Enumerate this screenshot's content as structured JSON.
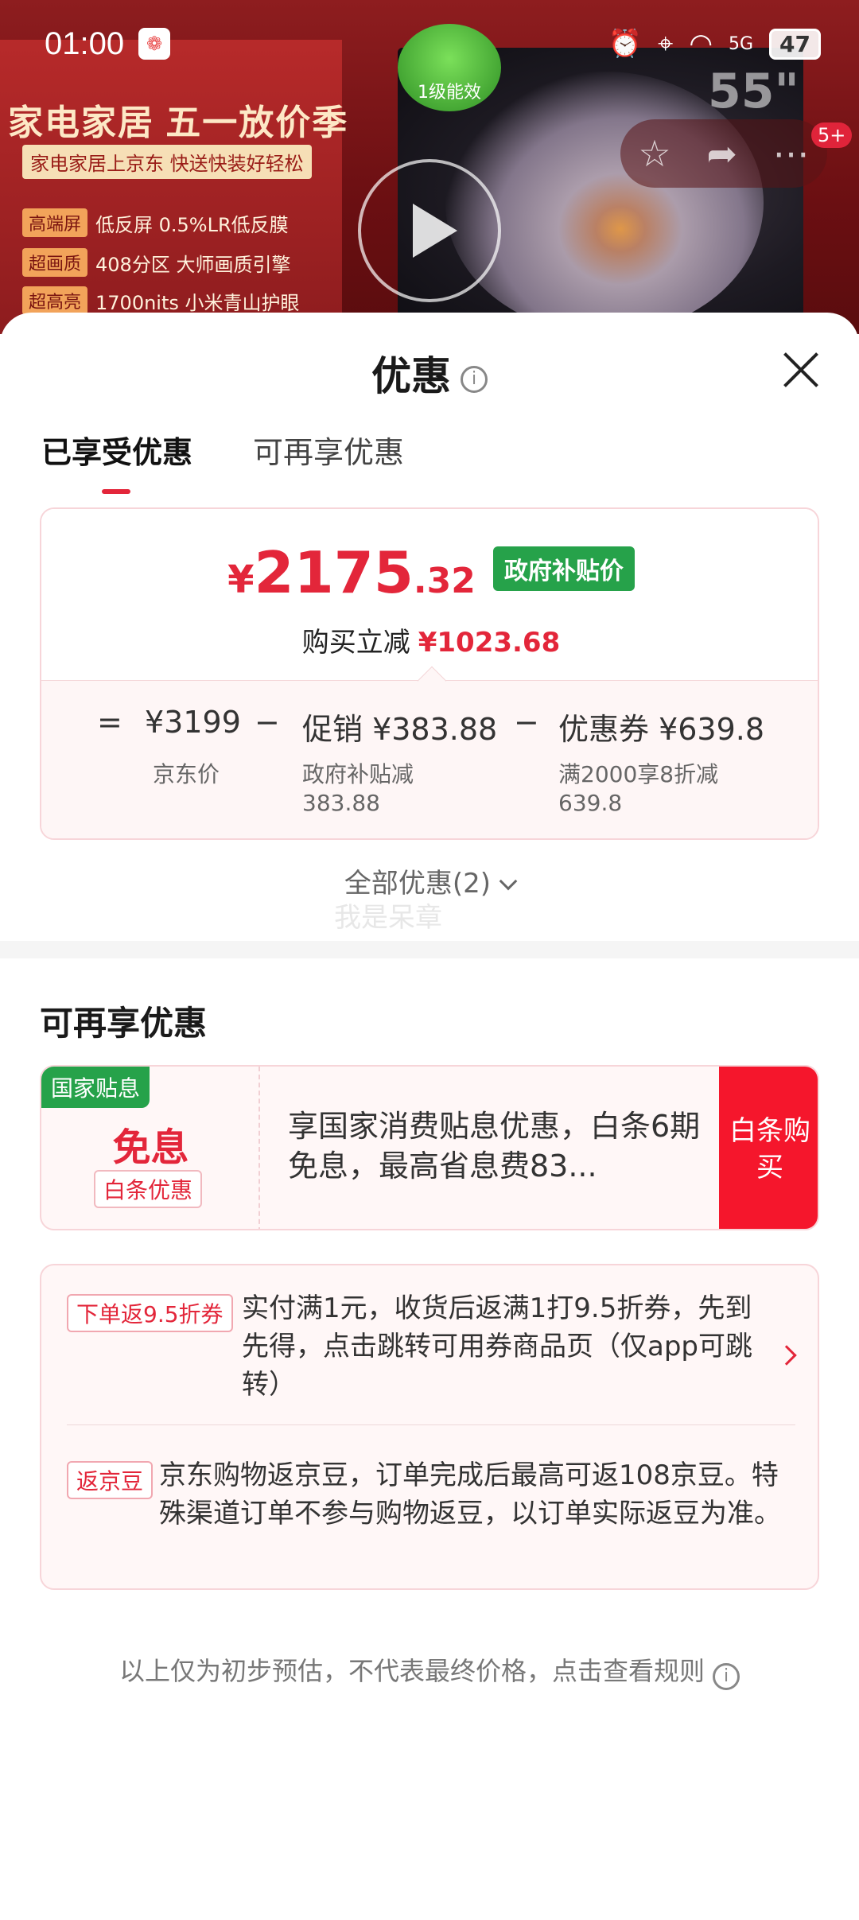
{
  "status_bar": {
    "time": "01:00",
    "battery": "47",
    "network": "5G"
  },
  "background": {
    "banner_title": "家电家居 五一放价季",
    "banner_sub": "家电家居上京东 快送快装好轻松",
    "energy_label": "1级能效",
    "screen_size": "55\"",
    "features": [
      {
        "tag": "高端屏",
        "text": "低反屏 0.5%LR低反膜"
      },
      {
        "tag": "超画质",
        "text": "408分区 大师画质引擎"
      },
      {
        "tag": "超高亮",
        "text": "1700nits 小米青山护眼"
      }
    ],
    "cart_badge": "5+"
  },
  "sheet": {
    "title": "优惠",
    "tabs": [
      {
        "label": "已享受优惠",
        "active": true
      },
      {
        "label": "可再享优惠",
        "active": false
      }
    ]
  },
  "price": {
    "currency": "¥",
    "integer": "2175",
    "decimal": ".32",
    "badge": "政府补贴价",
    "reduce_label": "购买立减",
    "reduce_amount": "¥1023.68",
    "calc": {
      "eq": "=",
      "jd_price": "¥3199",
      "minus1": "−",
      "promo": "促销 ¥383.88",
      "minus2": "−",
      "coupon": "优惠券 ¥639.8",
      "jd_label": "京东价",
      "promo_label_1": "政府补贴减",
      "promo_label_2": "383.88",
      "coupon_label_1": "满2000享8折减",
      "coupon_label_2": "639.8"
    }
  },
  "all_discounts": "全部优惠(2)",
  "watermark": "我是呆章",
  "more_section": {
    "title": "可再享优惠",
    "interest_free": {
      "tag": "国家贴息",
      "main": "免息",
      "sub": "白条优惠",
      "text": "享国家消费贴息优惠，白条6期免息，最高省息费83...",
      "button": "白条购买"
    },
    "promos": [
      {
        "tag": "下单返9.5折券",
        "text": "实付满1元，收货后返满1打9.5折券，先到先得，点击跳转可用券商品页（仅app可跳转）"
      },
      {
        "tag": "返京豆",
        "text": "京东购物返京豆，订单完成后最高可返108京豆。特殊渠道订单不参与购物返豆，以订单实际返豆为准。"
      }
    ]
  },
  "footer_note": "以上仅为初步预估，不代表最终价格，点击查看规则",
  "colors": {
    "accent_red": "#e3263a",
    "gov_green": "#26a24a",
    "buy_red": "#f5162c"
  }
}
